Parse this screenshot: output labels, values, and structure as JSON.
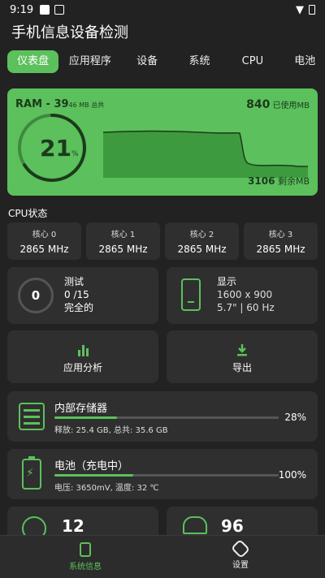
{
  "status_bar": {
    "time": "9:19"
  },
  "app": {
    "title": "手机信息设备检测"
  },
  "tabs": [
    "仪表盘",
    "应用程序",
    "设备",
    "系统",
    "CPU",
    "电池"
  ],
  "ram": {
    "label": "RAM - 39",
    "total_suffix": "46 MB 总共",
    "used_value": "840",
    "used_label": " 已使用MB",
    "percent": "21",
    "percent_sign": "%",
    "percent_value": 21,
    "free_value": "3106",
    "free_label": " 剩余MB"
  },
  "cpu": {
    "title": "CPU状态",
    "cores": [
      {
        "name": "核心 0",
        "freq": "2865 MHz"
      },
      {
        "name": "核心 1",
        "freq": "2865 MHz"
      },
      {
        "name": "核心 2",
        "freq": "2865 MHz"
      },
      {
        "name": "核心 3",
        "freq": "2865 MHz"
      }
    ]
  },
  "test": {
    "count": "0",
    "title": "测试",
    "progress": "0 /15",
    "status": "完全的"
  },
  "display": {
    "title": "显示",
    "resolution": "1600 x 900",
    "detail": "5.7\" | 60 Hz"
  },
  "actions": {
    "app_analysis": "应用分析",
    "export": "导出"
  },
  "storage": {
    "title": "内部存储器",
    "detail": "释放: 25.4 GB,  总共: 35.6 GB",
    "percent": "28%",
    "fill": 0.28
  },
  "battery": {
    "title": "电池（充电中）",
    "detail": "电压: 3650mV,  温度: 32 ℃",
    "percent": "100%",
    "fill": 0.35
  },
  "mini": {
    "left_value": "12",
    "right_value": "96"
  },
  "nav": {
    "system_info": "系统信息",
    "settings": "设置"
  },
  "colors": {
    "accent": "#5cc05c",
    "background": "#222222",
    "card": "#2f2f2f"
  }
}
